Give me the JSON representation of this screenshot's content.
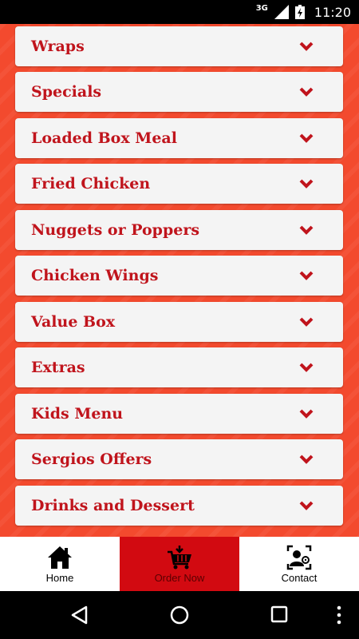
{
  "status_bar": {
    "network": "3G",
    "time": "11:20"
  },
  "menu": {
    "items": [
      {
        "label": "Wraps"
      },
      {
        "label": "Specials"
      },
      {
        "label": "Loaded Box Meal"
      },
      {
        "label": "Fried Chicken"
      },
      {
        "label": "Nuggets or Poppers"
      },
      {
        "label": "Chicken Wings"
      },
      {
        "label": "Value Box"
      },
      {
        "label": "Extras"
      },
      {
        "label": "Kids Menu"
      },
      {
        "label": "Sergios Offers"
      },
      {
        "label": "Drinks and Dessert"
      }
    ]
  },
  "bottom_nav": {
    "tabs": [
      {
        "label": "Home",
        "icon": "home-icon",
        "active": false
      },
      {
        "label": "Order Now",
        "icon": "basket-icon",
        "active": true
      },
      {
        "label": "Contact",
        "icon": "contact-icon",
        "active": false
      }
    ]
  },
  "colors": {
    "background": "#f34a2e",
    "item_text": "#c0141c",
    "active_tab": "#d20a11"
  }
}
